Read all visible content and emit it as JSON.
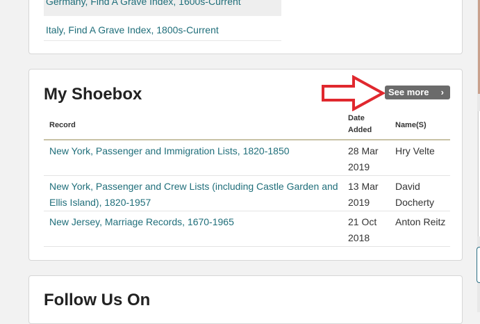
{
  "top_card": {
    "items": [
      "Germany, Find A Grave Index, 1600s-Current",
      "Italy, Find A Grave Index, 1800s-Current"
    ]
  },
  "shoebox": {
    "title": "My Shoebox",
    "see_more": "See more",
    "see_more_icon": "chevron-right-icon",
    "annotation_color": "#e0282e",
    "columns": {
      "record": "Record",
      "date": "Date Added",
      "names": "Name(S)"
    },
    "rows": [
      {
        "record": "New York, Passenger and Immigration Lists, 1820-1850",
        "date": "28 Mar 2019",
        "name": "Hry Velte"
      },
      {
        "record": "New York, Passenger and Crew Lists (including Castle Garden and Ellis Island), 1820-1957",
        "date": "13 Mar 2019",
        "name": "David Docherty"
      },
      {
        "record": "New Jersey, Marriage Records, 1670-1965",
        "date": "21 Oct 2018",
        "name": "Anton Reitz"
      }
    ]
  },
  "follow": {
    "title": "Follow Us On"
  },
  "colors": {
    "link": "#1f6e7a",
    "button_bg": "#6b6b6b",
    "rule": "#c9c2a6"
  }
}
